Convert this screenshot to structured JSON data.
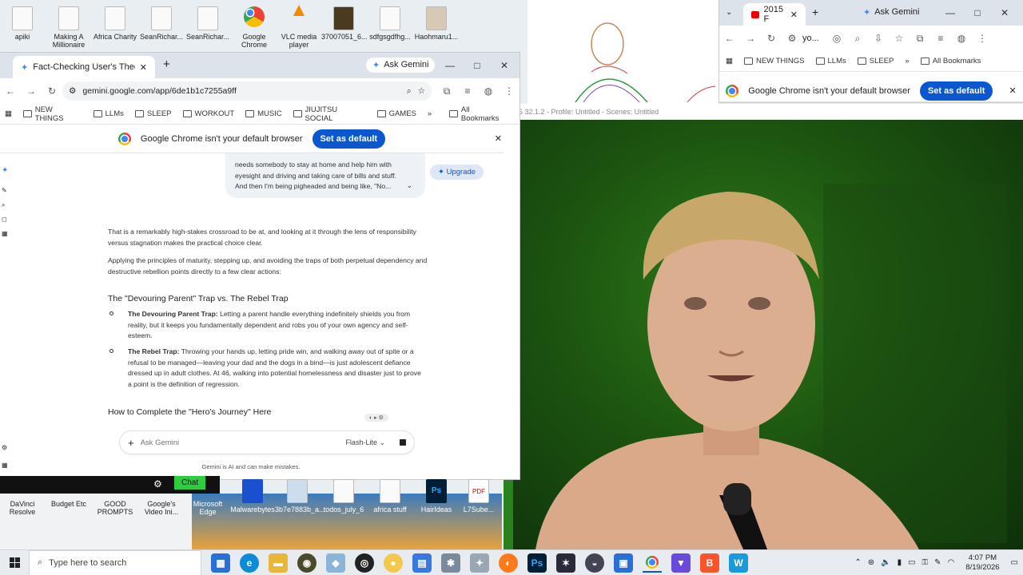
{
  "desktop_top_icons": [
    "apiki",
    "Making A Millionaire",
    "Africa Charity",
    "SeanRichar...",
    "SeanRichar...",
    "Google Chrome",
    "VLC media player",
    "37007051_6...",
    "sdfgsgdfhg...",
    "Haohmaru1..."
  ],
  "desktop_bottom_icons": [
    "DaVinci Resolve",
    "Budget Etc",
    "GOOD PROMPTS",
    "Google's Video Ini...",
    "Microsoft Edge",
    "Malwarebytes",
    "3b7e7883b_a...",
    "todos_july_6",
    "africa stuff",
    "HairIdeas",
    "L7Sube..."
  ],
  "chat_button_label": "Chat",
  "main_window": {
    "tab_title": "Fact-Checking User's Theories",
    "ask_gemini_label": "Ask Gemini",
    "url": "gemini.google.com/app/6de1b1c7255a9ff",
    "bookmarks": [
      "NEW THINGS",
      "LLMs",
      "SLEEP",
      "WORKOUT",
      "MUSIC",
      "JIUJITSU SOCIAL",
      "GAMES"
    ],
    "all_bookmarks": "All Bookmarks",
    "infobar_text": "Google Chrome isn't your default browser",
    "set_default": "Set as default"
  },
  "gemini": {
    "upgrade_label": "Upgrade",
    "user_bubble_lines": [
      "needs somebody to stay at home and help him with",
      "eyesight and driving and taking care of bills and stuff.",
      "And then I'm being pigheaded and being like, \"No..."
    ],
    "para1": "That is a remarkably high-stakes crossroad to be at, and looking at it through the lens of responsibility versus stagnation makes the practical choice clear.",
    "para2": "Applying the principles of maturity, stepping up, and avoiding the traps of both perpetual dependency and destructive rebellion points directly to a few clear actions:",
    "heading1": "The \"Devouring Parent\" Trap vs. The Rebel Trap",
    "bullet1_bold": "The Devouring Parent Trap:",
    "bullet1_text": " Letting a parent handle everything indefinitely shields you from reality, but it keeps you fundamentally dependent and robs you of your own agency and self-esteem.",
    "bullet2_bold": "The Rebel Trap:",
    "bullet2_text": " Throwing your hands up, letting pride win, and walking away out of spite or a refusal to be managed—leaving your dad and the dogs in a bind—is just adolescent defiance dressed up in adult clothes. At 46, walking into potential homelessness and disaster just to prove a point is the definition of regression.",
    "heading2": "How to Complete the \"Hero's Journey\" Here",
    "input_placeholder": "Ask Gemini",
    "model_label": "Flash-Lite",
    "disclaimer": "Gemini is AI and can make mistakes."
  },
  "second_window": {
    "tab_title": "2015 F",
    "ask_gemini_label": "Ask Gemini",
    "url": "yo...",
    "bookmarks": [
      "NEW THINGS",
      "LLMs",
      "SLEEP"
    ],
    "all_bookmarks": "All Bookmarks",
    "infobar_text": "Google Chrome isn't your default browser",
    "set_default": "Set as default"
  },
  "obs_title": "S 32.1.2 - Profile: Untitled - Scenes: Untitled",
  "taskbar": {
    "search_placeholder": "Type here to search",
    "time": "4:07 PM",
    "date": "8/19/2026"
  },
  "colors": {
    "accent": "#0b57d0",
    "webcam_green": "#1c5410",
    "gemini_blue": "#4285f4"
  }
}
